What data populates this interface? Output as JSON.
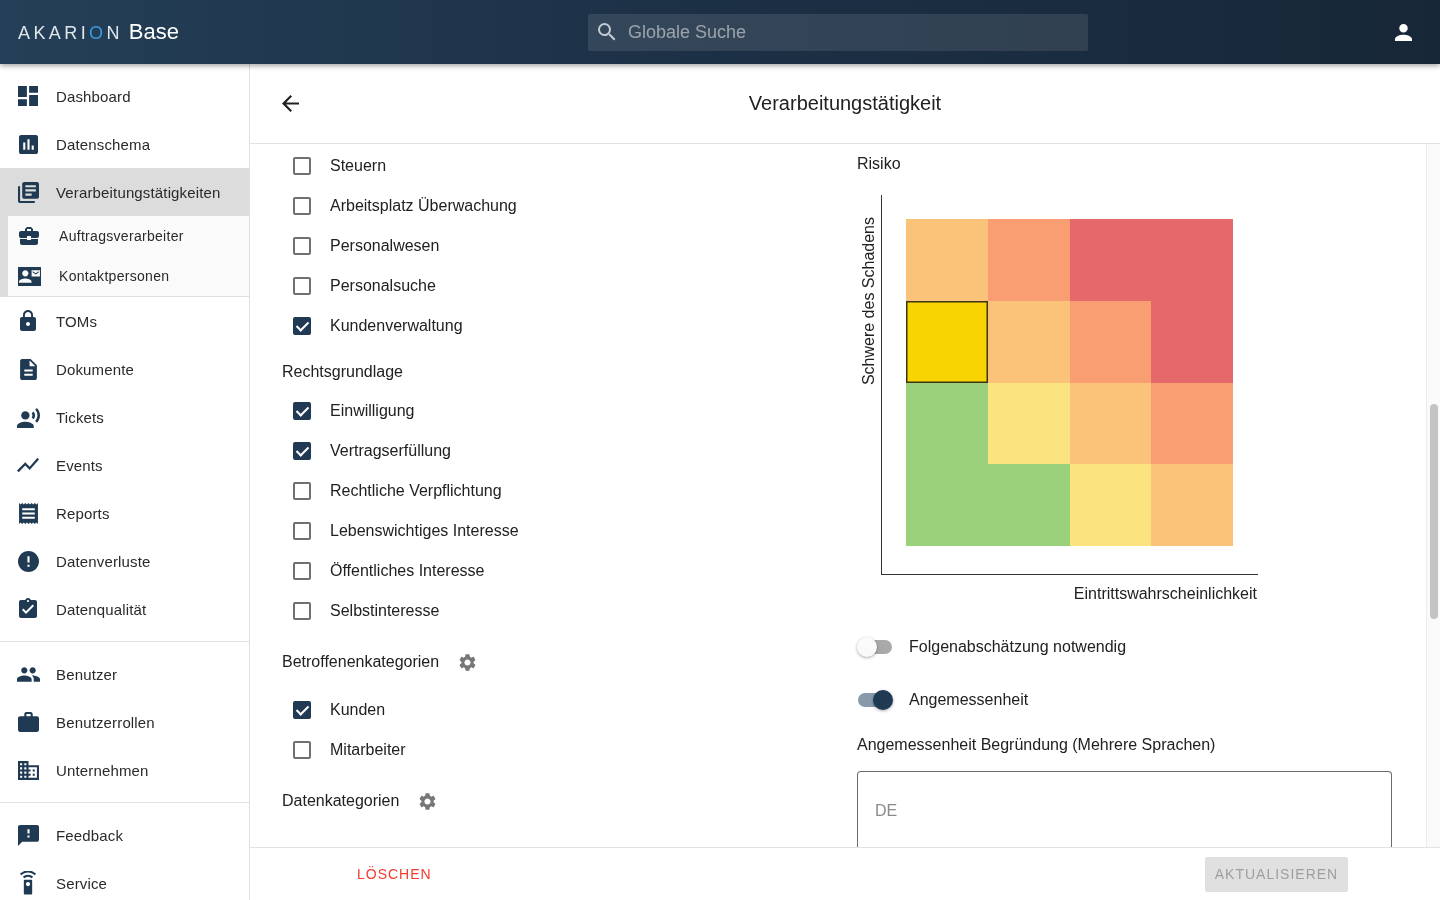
{
  "header": {
    "brand": "AKARION",
    "product": "Base",
    "search": {
      "placeholder": "Globale Suche"
    }
  },
  "sidebar": {
    "groups": [
      {
        "items": [
          {
            "label": "Dashboard",
            "selected": false
          },
          {
            "label": "Datenschema",
            "selected": false
          },
          {
            "label": "Verarbeitungstätigkeiten",
            "selected": true,
            "expanded": true,
            "children": [
              {
                "label": "Auftragsverarbeiter",
                "selected": false
              },
              {
                "label": "Kontaktpersonen",
                "selected": false
              }
            ]
          },
          {
            "label": "TOMs",
            "selected": false
          },
          {
            "label": "Dokumente",
            "selected": false
          },
          {
            "label": "Tickets",
            "selected": false
          },
          {
            "label": "Events",
            "selected": false
          },
          {
            "label": "Reports",
            "selected": false
          },
          {
            "label": "Datenverluste",
            "selected": false
          },
          {
            "label": "Datenqualität",
            "selected": false
          }
        ]
      },
      {
        "items": [
          {
            "label": "Benutzer",
            "selected": false
          },
          {
            "label": "Benutzerrollen",
            "selected": false
          },
          {
            "label": "Unternehmen",
            "selected": false
          }
        ]
      },
      {
        "items": [
          {
            "label": "Feedback",
            "selected": false
          },
          {
            "label": "Service",
            "selected": false
          }
        ]
      }
    ]
  },
  "page": {
    "title": "Verarbeitungstätigkeit"
  },
  "sections": [
    {
      "items": [
        {
          "label": "Steuern",
          "checked": false
        },
        {
          "label": "Arbeitsplatz Überwachung",
          "checked": false
        },
        {
          "label": "Personalwesen",
          "checked": false
        },
        {
          "label": "Personalsuche",
          "checked": false
        },
        {
          "label": "Kundenverwaltung",
          "checked": true
        }
      ]
    },
    {
      "heading": "Rechtsgrundlage",
      "has_settings": false,
      "items": [
        {
          "label": "Einwilligung",
          "checked": true
        },
        {
          "label": "Vertragserfüllung",
          "checked": true
        },
        {
          "label": "Rechtliche Verpflichtung",
          "checked": false
        },
        {
          "label": "Lebenswichtiges Interesse",
          "checked": false
        },
        {
          "label": "Öffentliches Interesse",
          "checked": false
        },
        {
          "label": "Selbstinteresse",
          "checked": false
        }
      ]
    },
    {
      "heading": "Betroffenenkategorien",
      "has_settings": true,
      "items": [
        {
          "label": "Kunden",
          "checked": true
        },
        {
          "label": "Mitarbeiter",
          "checked": false
        }
      ]
    },
    {
      "heading": "Datenkategorien",
      "has_settings": true
    }
  ],
  "risk": {
    "title": "Risiko",
    "y_label": "Schwere des Schadens",
    "x_label": "Eintrittswahrscheinlichkeit",
    "rows": [
      {
        "cells": [
          {
            "color": "#fbc379",
            "selected": false
          },
          {
            "color": "#f99d72",
            "selected": false
          },
          {
            "color": "#e5696a",
            "selected": false
          },
          {
            "color": "#e5696a",
            "selected": false
          }
        ]
      },
      {
        "cells": [
          {
            "color": "#f8d403",
            "selected": true
          },
          {
            "color": "#fbc379",
            "selected": false
          },
          {
            "color": "#f99d72",
            "selected": false
          },
          {
            "color": "#e5696a",
            "selected": false
          }
        ]
      },
      {
        "cells": [
          {
            "color": "#9bd17b",
            "selected": false
          },
          {
            "color": "#fbe47f",
            "selected": false
          },
          {
            "color": "#fbc379",
            "selected": false
          },
          {
            "color": "#f99d72",
            "selected": false
          }
        ]
      },
      {
        "cells": [
          {
            "color": "#9bd17b",
            "selected": false
          },
          {
            "color": "#9bd17b",
            "selected": false
          },
          {
            "color": "#fbe47f",
            "selected": false
          },
          {
            "color": "#fbc379",
            "selected": false
          }
        ]
      }
    ]
  },
  "toggles": [
    {
      "label": "Folgenabschätzung notwendig",
      "on": false
    },
    {
      "label": "Angemessenheit",
      "on": true
    }
  ],
  "justification": {
    "label": "Angemessenheit Begründung (Mehrere Sprachen)",
    "placeholder": "DE"
  },
  "footer": {
    "delete_button": "LÖSCHEN",
    "update_button": {
      "label": "AKTUALISIEREN",
      "disabled": true
    }
  }
}
